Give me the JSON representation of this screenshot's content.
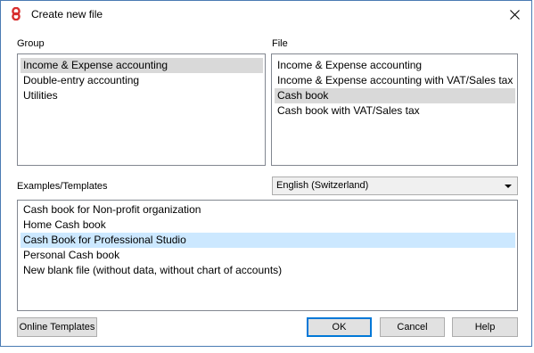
{
  "window": {
    "title": "Create new file"
  },
  "group": {
    "label": "Group",
    "items": [
      "Income & Expense accounting",
      "Double-entry accounting",
      "Utilities"
    ],
    "selected_index": 0
  },
  "file": {
    "label": "File",
    "items": [
      "Income & Expense accounting",
      "Income & Expense accounting with VAT/Sales tax",
      "Cash book",
      "Cash book with VAT/Sales tax"
    ],
    "selected_index": 2
  },
  "templates": {
    "label": "Examples/Templates",
    "language": "English (Switzerland)",
    "items": [
      "Cash book for Non-profit organization",
      "Home Cash book",
      "Cash Book for Professional Studio",
      "Personal Cash book",
      "New blank file (without data, without chart of accounts)"
    ],
    "selected_index": 2
  },
  "buttons": {
    "online_templates": "Online Templates",
    "ok": "OK",
    "cancel": "Cancel",
    "help": "Help"
  },
  "colors": {
    "border_accent": "#4a7bb3",
    "selection_gray": "#d9d9d9",
    "selection_blue": "#cce8ff",
    "app_icon_red": "#d72d2d"
  }
}
